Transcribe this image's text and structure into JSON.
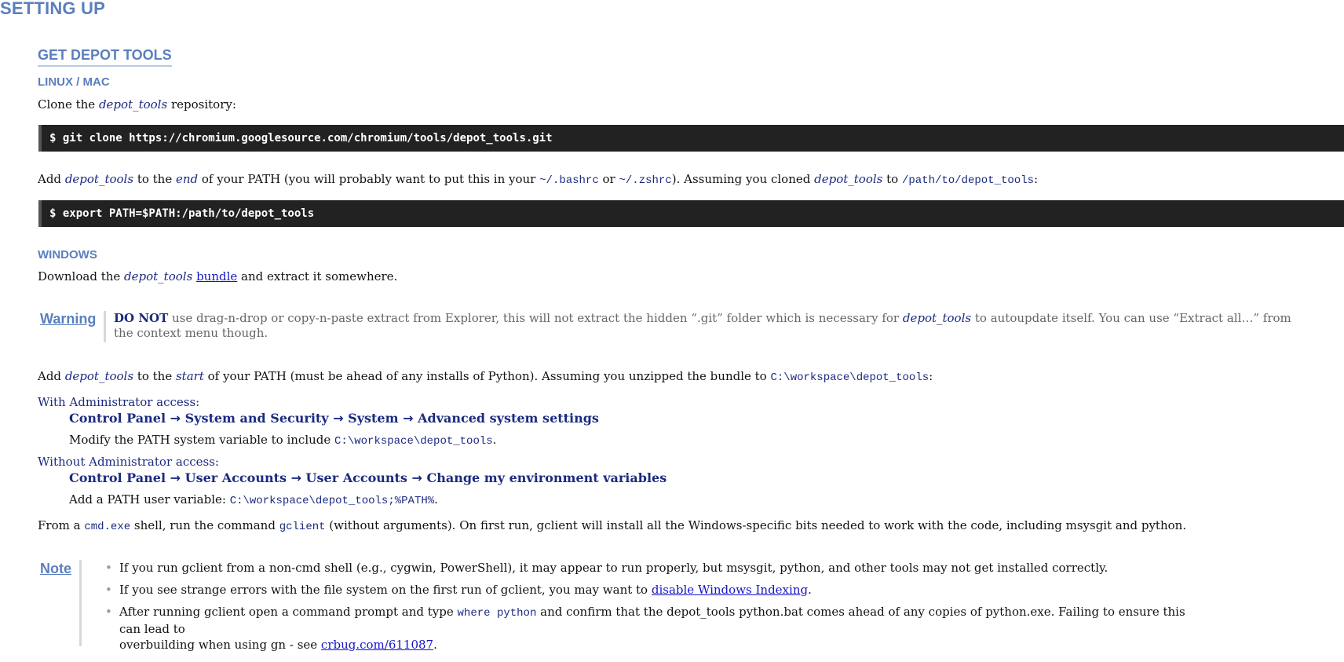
{
  "title": "SETTING UP",
  "section": "GET DEPOT TOOLS",
  "linux": {
    "heading": "LINUX / MAC",
    "clone_pre": "Clone the ",
    "clone_em": "depot_tools",
    "clone_post": " repository:",
    "code1": "$ git clone https://chromium.googlesource.com/chromium/tools/depot_tools.git",
    "add_pre": "Add ",
    "add_em": "depot_tools",
    "add_mid1": " to the ",
    "add_end": "end",
    "add_mid2": " of your PATH (you will probably want to put this in your ",
    "bashrc": "~/.bashrc",
    "or": " or ",
    "zshrc": "~/.zshrc",
    "assume_pre": "). Assuming you cloned ",
    "assume_em": "depot_tools",
    "to": " to ",
    "path": "/path/to/depot_tools",
    "colon": ":",
    "code2": "$ export PATH=$PATH:/path/to/depot_tools"
  },
  "windows": {
    "heading": "WINDOWS",
    "download_pre": "Download the ",
    "download_em": "depot_tools",
    "bundle_link": "bundle",
    "download_post": " and extract it somewhere.",
    "warning_label": "Warning",
    "warning_strong": "DO NOT",
    "warning_text1": " use drag-n-drop or copy-n-paste extract from Explorer, this will not extract the hidden “.git” folder which is necessary for ",
    "warning_em": "depot_tools",
    "warning_text2": " to autoupdate itself. You can use “Extract all…” from",
    "warning_text3": "the context menu though.",
    "add_pre": "Add ",
    "add_em": "depot_tools",
    "add_mid": " to the ",
    "add_start": "start",
    "add_post": " of your PATH (must be ahead of any installs of Python). Assuming you unzipped the bundle to ",
    "workspace_path": "C:\\workspace\\depot_tools",
    "colon": ":",
    "admin_label": "With Administrator access:",
    "admin_path": [
      "Control Panel",
      "System and Security",
      "System",
      "Advanced system settings"
    ],
    "admin_modify_pre": "Modify the PATH system variable to include ",
    "admin_modify_code": "C:\\workspace\\depot_tools",
    "period": ".",
    "noadmin_label": "Without Administrator access:",
    "noadmin_path": [
      "Control Panel",
      "User Accounts",
      "User Accounts",
      "Change my environment variables"
    ],
    "noadmin_add_pre": "Add a PATH user variable: ",
    "noadmin_add_code": "C:\\workspace\\depot_tools;%PATH%",
    "arrow": "→",
    "from_pre": "From a ",
    "cmd": "cmd.exe",
    "from_mid": " shell, run the command ",
    "gclient": "gclient",
    "from_post": " (without arguments). On first run, gclient will install all the Windows-specific bits needed to work with the code, including msysgit and python.",
    "note_label": "Note",
    "note1": "If you run gclient from a non-cmd shell (e.g., cygwin, PowerShell), it may appear to run properly, but msysgit, python, and other tools may not get installed correctly.",
    "note2_pre": "If you see strange errors with the file system on the first run of gclient, you may want to ",
    "note2_link": "disable Windows Indexing",
    "note3_pre": "After running gclient open a command prompt and type ",
    "note3_code": "where python",
    "note3_mid": " and confirm that the depot_tools python.bat comes ahead of any copies of python.exe. Failing to ensure this can lead to",
    "note3_line2": "overbuilding when using gn - see ",
    "note3_link": "crbug.com/611087"
  }
}
